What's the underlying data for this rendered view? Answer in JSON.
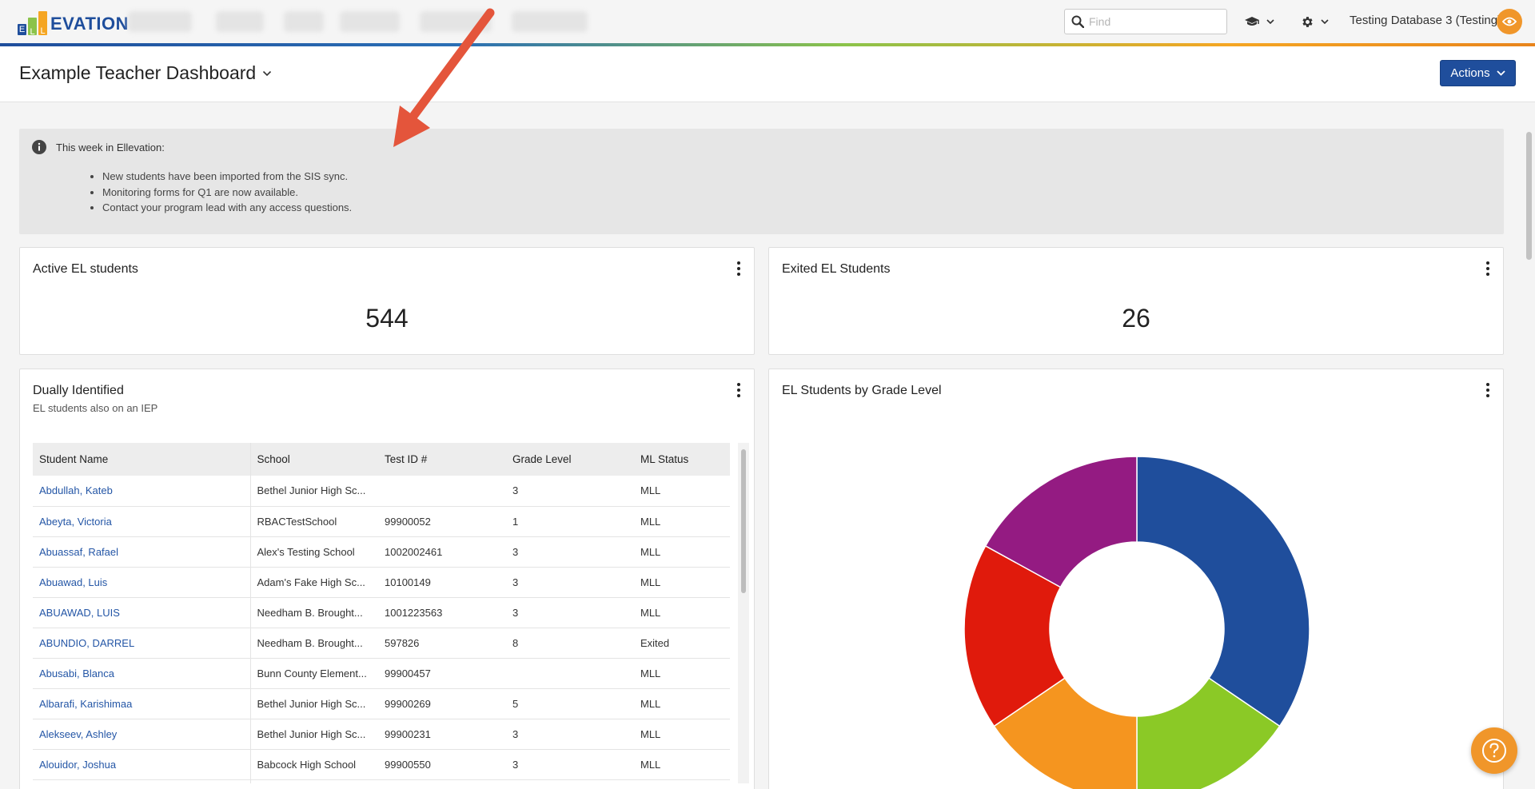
{
  "brand": {
    "logo_text": "EVATION",
    "logo_letters": [
      "E",
      "L",
      "L"
    ]
  },
  "nav": {
    "search_placeholder": "Find",
    "tenant": "Testing Database 3 (Testing)"
  },
  "header": {
    "title": "Example Teacher Dashboard",
    "actions_label": "Actions"
  },
  "announcement": {
    "heading": "This week in Ellevation:",
    "items": [
      "New students have been imported from the SIS sync.",
      "Monitoring forms for Q1 are now available.",
      "Contact your program lead with any access questions."
    ]
  },
  "cards": {
    "active": {
      "title": "Active EL students",
      "value": "544"
    },
    "exited": {
      "title": "Exited EL Students",
      "value": "26"
    },
    "dual": {
      "title": "Dually Identified",
      "subtitle": "EL students also on an IEP",
      "columns": [
        "Student Name",
        "School",
        "Test ID #",
        "Grade Level",
        "ML Status"
      ],
      "rows": [
        [
          "Abdullah, Kateb",
          "Bethel Junior High Sc...",
          "",
          "3",
          "MLL"
        ],
        [
          "Abeyta, Victoria",
          "RBACTestSchool",
          "99900052",
          "1",
          "MLL"
        ],
        [
          "Abuassaf, Rafael",
          "Alex's Testing School",
          "1002002461",
          "3",
          "MLL"
        ],
        [
          "Abuawad, Luis",
          "Adam's Fake High Sc...",
          "10100149",
          "3",
          "MLL"
        ],
        [
          "ABUAWAD, LUIS",
          "Needham B. Brought...",
          "1001223563",
          "3",
          "MLL"
        ],
        [
          "ABUNDIO, DARREL",
          "Needham B. Brought...",
          "597826",
          "8",
          "Exited"
        ],
        [
          "Abusabi, Blanca",
          "Bunn County Element...",
          "99900457",
          "",
          "MLL"
        ],
        [
          "Albarafi, Karishimaa",
          "Bethel Junior High Sc...",
          "99900269",
          "5",
          "MLL"
        ],
        [
          "Alekseev, Ashley",
          "Bethel Junior High Sc...",
          "99900231",
          "3",
          "MLL"
        ],
        [
          "Alouidor, Joshua",
          "Babcock High School",
          "99900550",
          "3",
          "MLL"
        ],
        [
          "",
          "",
          "",
          "",
          ""
        ]
      ]
    },
    "grade": {
      "title": "EL Students by Grade Level"
    }
  },
  "chart_data": {
    "type": "pie",
    "donut": true,
    "title": "EL Students by Grade Level",
    "slices": [
      {
        "value": 34.5,
        "color": "#1f4e9c"
      },
      {
        "value": 15.5,
        "color": "#8bc926"
      },
      {
        "value": 15.5,
        "color": "#f5951f"
      },
      {
        "value": 17.5,
        "color": "#e01a0c"
      },
      {
        "value": 17.0,
        "color": "#941b82"
      }
    ]
  },
  "colors": {
    "accent": "#1f4e9c",
    "orange": "#f0962a",
    "link": "#2456a6"
  }
}
